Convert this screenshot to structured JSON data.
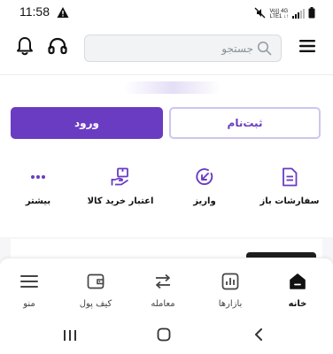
{
  "status_bar": {
    "time": "11:58",
    "network_label_top": "Vo)) 4G",
    "network_label_bottom": "LTE1 ↓↑"
  },
  "header": {
    "search_placeholder": "جستجو"
  },
  "auth": {
    "login_label": "ورود",
    "signup_label": "ثبت‌نام"
  },
  "shortcuts": [
    {
      "label": "سفارشات باز",
      "icon": "open-orders-icon"
    },
    {
      "label": "واریز",
      "icon": "deposit-icon"
    },
    {
      "label": "اعتبار خرید کالا",
      "icon": "purchase-credit-icon"
    },
    {
      "label": "بیشتر",
      "icon": "more-icon"
    }
  ],
  "bottom_nav": [
    {
      "label": "خانه",
      "icon": "home-icon",
      "active": true
    },
    {
      "label": "بازارها",
      "icon": "markets-icon"
    },
    {
      "label": "معامله",
      "icon": "trade-icon"
    },
    {
      "label": "کیف پول",
      "icon": "wallet-icon"
    },
    {
      "label": "منو",
      "icon": "menu-icon"
    }
  ],
  "colors": {
    "accent": "#6a3cc1",
    "accent_border": "#cfc5ee",
    "search_bg": "#f2f3f5"
  }
}
